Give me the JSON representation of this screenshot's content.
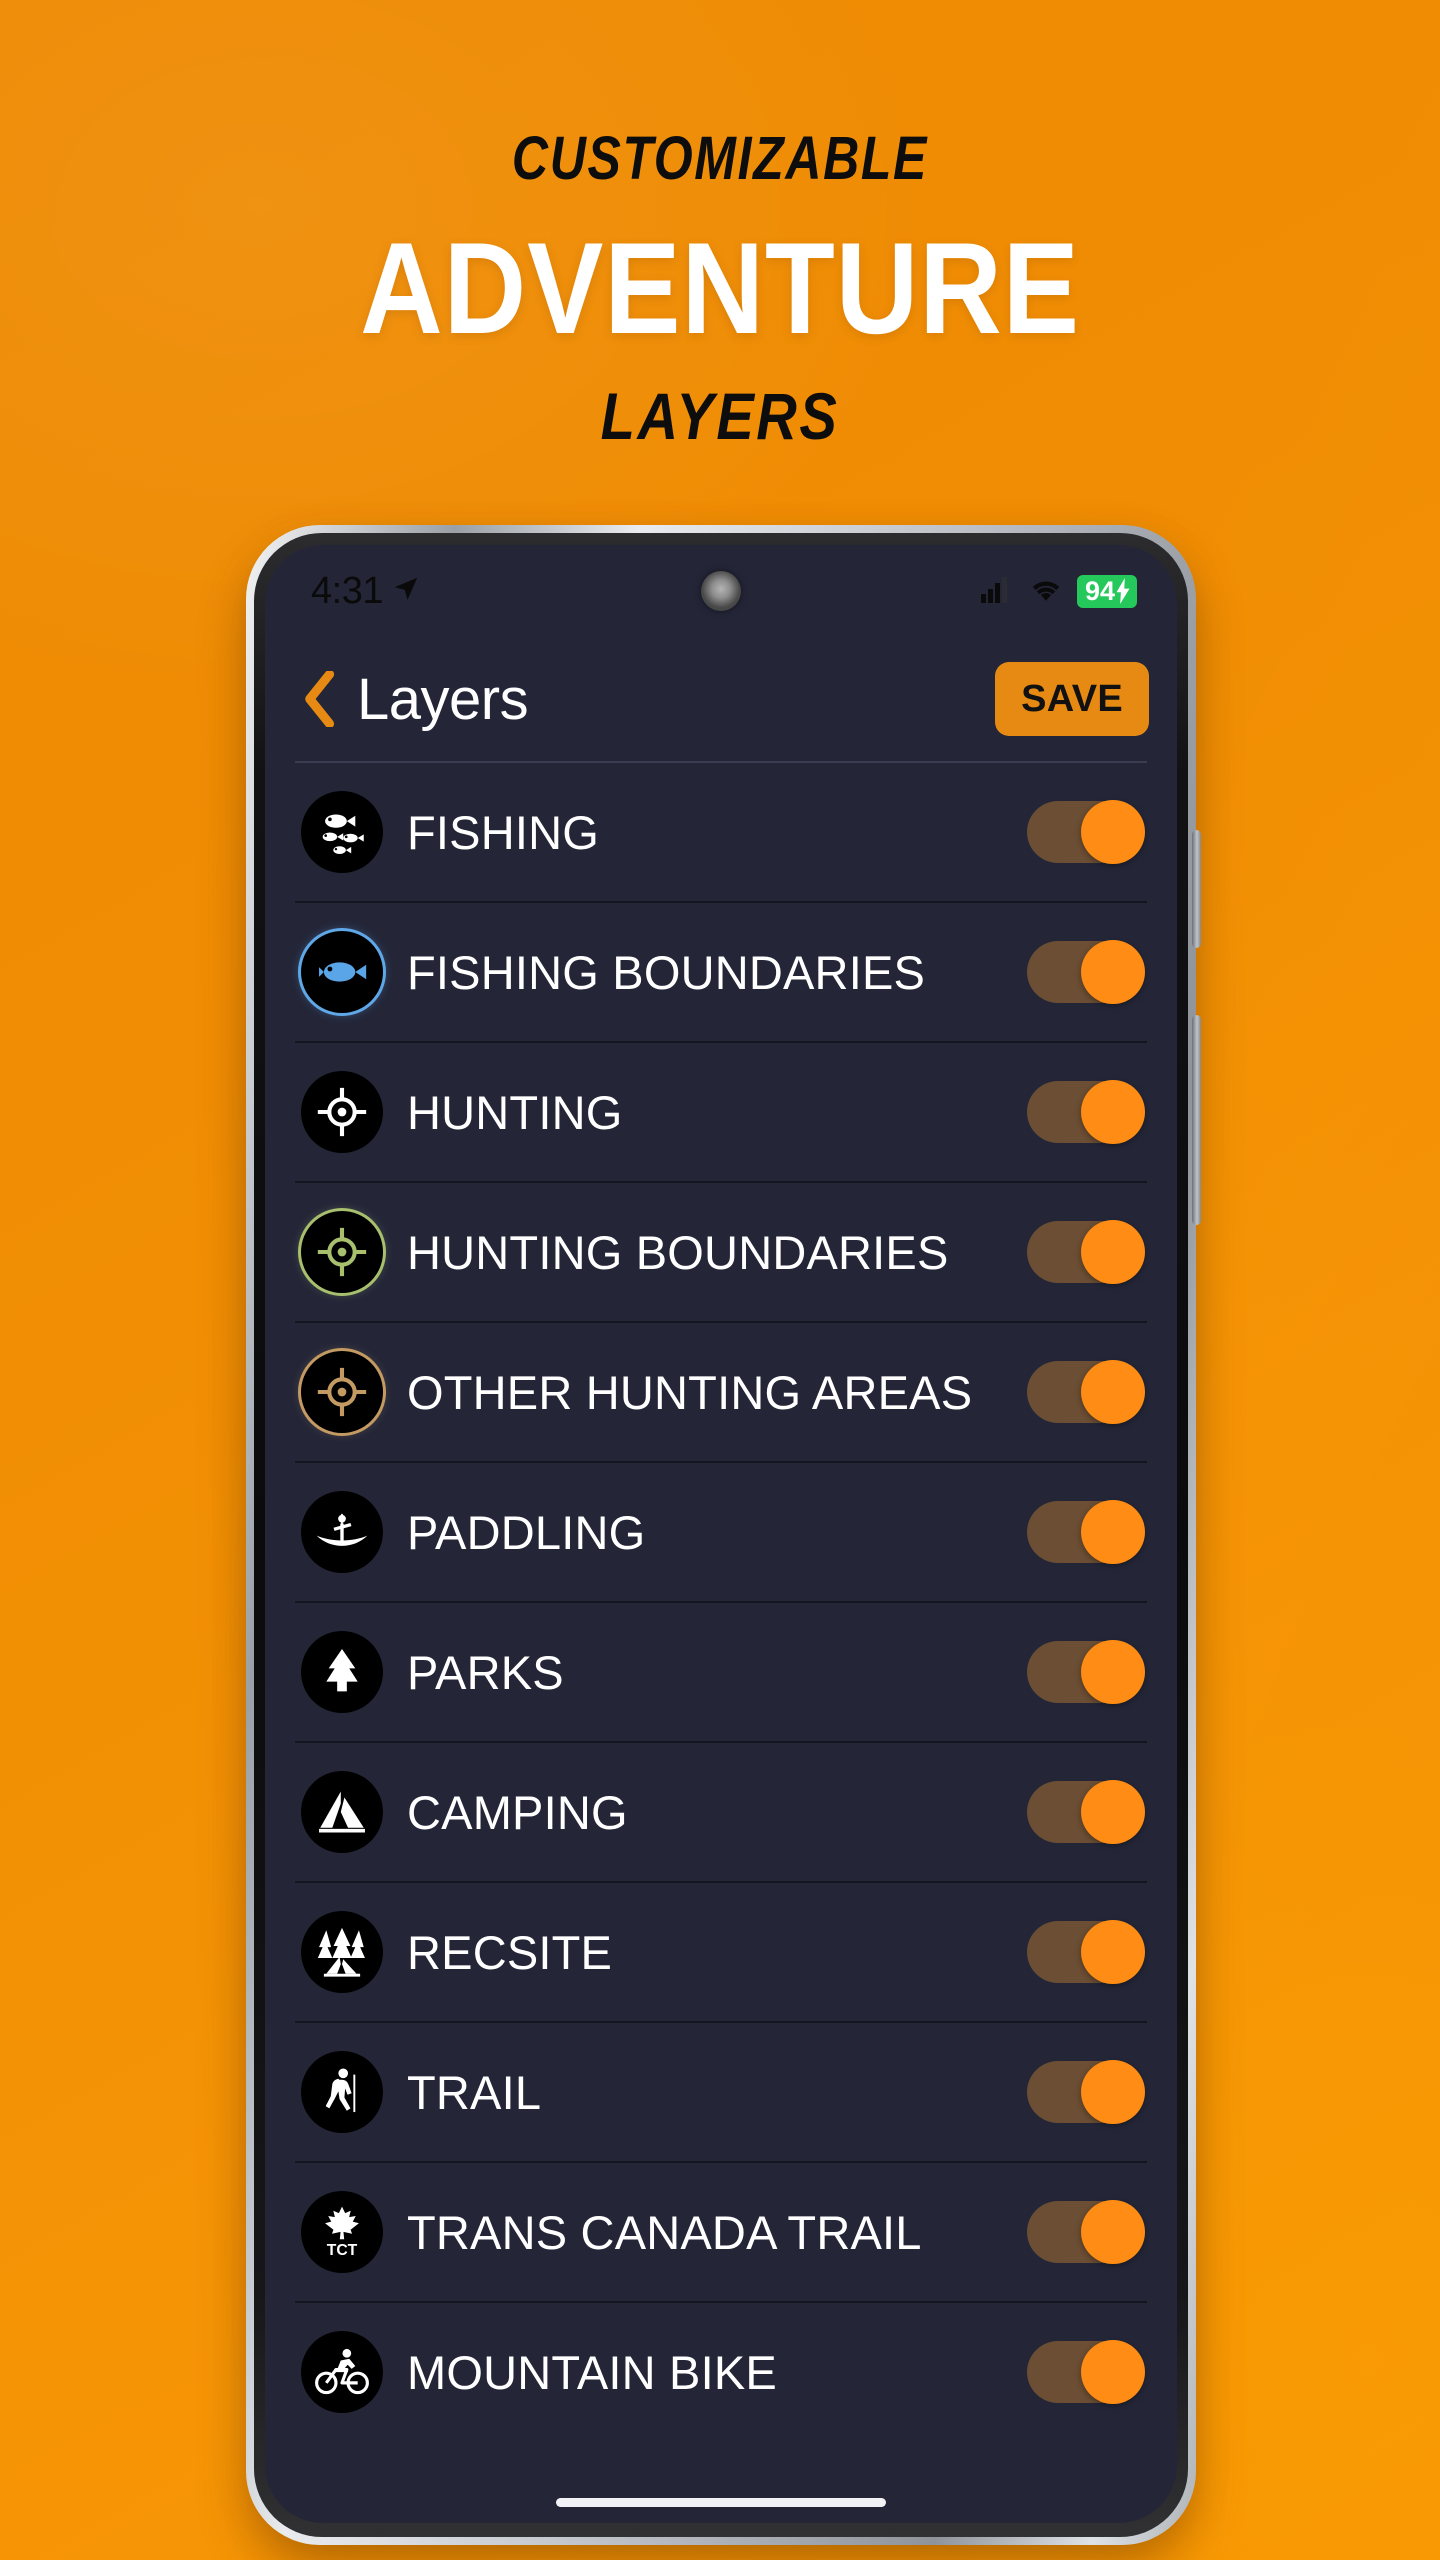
{
  "colors": {
    "bg_orange_top": "#ED8A05",
    "bg_orange_bottom": "#F59405",
    "accent_orange": "#E78A14",
    "toggle_knob": "#FF8C14",
    "toggle_track": "#6B4E33",
    "app_bg": "#242638",
    "battery_green": "#25C85B"
  },
  "headline": {
    "kicker": "CUSTOMIZABLE",
    "hero": "ADVENTURE",
    "subline": "LAYERS"
  },
  "phone": {
    "status_bar": {
      "time": "4:31",
      "location_icon": "navigation-arrow-icon",
      "camera": "punch-hole-camera",
      "signal_icon": "cellular-signal-icon",
      "wifi_icon": "wifi-icon",
      "battery_level": "94",
      "battery_charging_icon": "lightning-bolt-icon"
    },
    "app_header": {
      "back_icon": "chevron-left-icon",
      "title": "Layers",
      "save_label": "SAVE"
    },
    "layers": [
      {
        "label": "FISHING",
        "icon": "fish-school-icon",
        "ring": "none",
        "enabled": true
      },
      {
        "label": "FISHING BOUNDARIES",
        "icon": "fish-boundary-icon",
        "ring": "blue",
        "enabled": true
      },
      {
        "label": "HUNTING",
        "icon": "crosshair-icon",
        "ring": "none",
        "enabled": true
      },
      {
        "label": "HUNTING BOUNDARIES",
        "icon": "crosshair-boundary-icon",
        "ring": "green",
        "enabled": true
      },
      {
        "label": "OTHER HUNTING AREAS",
        "icon": "crosshair-other-icon",
        "ring": "tan",
        "enabled": true
      },
      {
        "label": "PADDLING",
        "icon": "canoe-icon",
        "ring": "none",
        "enabled": true
      },
      {
        "label": "PARKS",
        "icon": "pine-tree-icon",
        "ring": "none",
        "enabled": true
      },
      {
        "label": "CAMPING",
        "icon": "tent-icon",
        "ring": "none",
        "enabled": true
      },
      {
        "label": "RECSITE",
        "icon": "recsite-trees-tent-icon",
        "ring": "none",
        "enabled": true
      },
      {
        "label": "TRAIL",
        "icon": "hiker-icon",
        "ring": "none",
        "enabled": true
      },
      {
        "label": "TRANS CANADA TRAIL",
        "icon": "maple-leaf-tct-icon",
        "ring": "none",
        "enabled": true,
        "icon_text": "TCT"
      },
      {
        "label": "MOUNTAIN BIKE",
        "icon": "cyclist-icon",
        "ring": "none",
        "enabled": true
      }
    ],
    "home_indicator": "gesture-home-bar"
  }
}
